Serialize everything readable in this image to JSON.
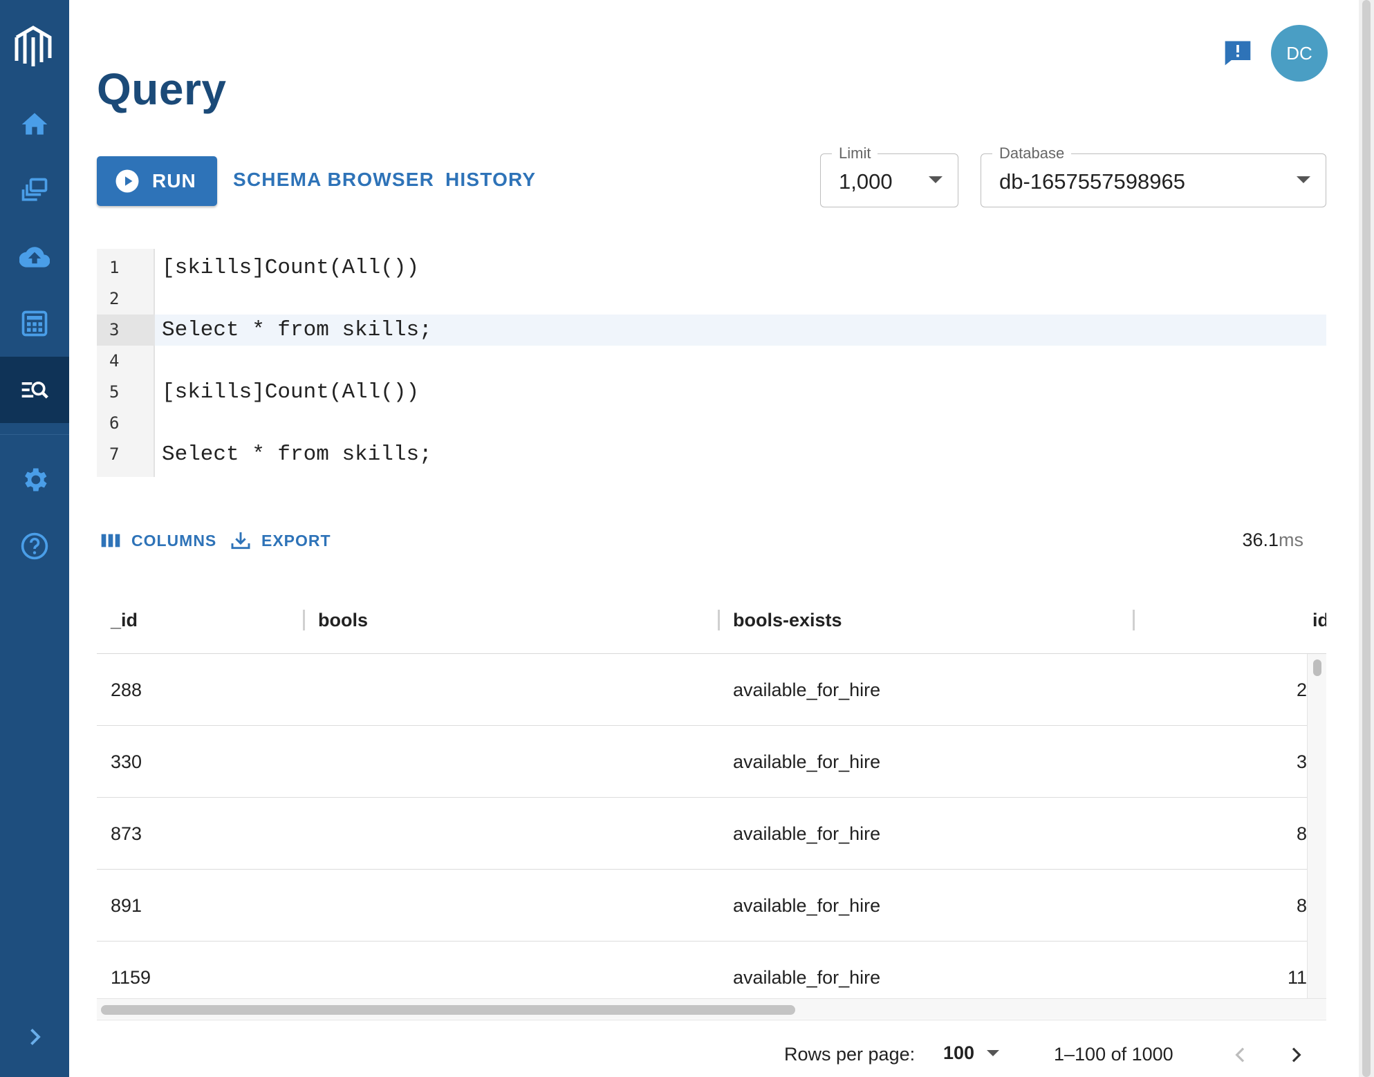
{
  "header": {
    "title": "Query",
    "avatar_initials": "DC"
  },
  "sidebar": {
    "items": [
      {
        "name": "home",
        "icon": "home-icon",
        "active": false
      },
      {
        "name": "collections",
        "icon": "stacked-layers-icon",
        "active": false
      },
      {
        "name": "upload",
        "icon": "cloud-upload-icon",
        "active": false
      },
      {
        "name": "calculator",
        "icon": "calculator-icon",
        "active": false
      },
      {
        "name": "query",
        "icon": "query-search-icon",
        "active": true
      },
      {
        "name": "settings",
        "icon": "gear-icon",
        "active": false
      },
      {
        "name": "help",
        "icon": "help-icon",
        "active": false
      }
    ]
  },
  "toolbar": {
    "run_label": "RUN",
    "schema_label": "SCHEMA BROWSER",
    "history_label": "HISTORY",
    "limit": {
      "label": "Limit",
      "value": "1,000"
    },
    "database": {
      "label": "Database",
      "value": "db-1657557598965"
    }
  },
  "editor": {
    "lines": [
      {
        "num": "1",
        "text": "[skills]Count(All())"
      },
      {
        "num": "2",
        "text": ""
      },
      {
        "num": "3",
        "text": "Select * from skills;"
      },
      {
        "num": "4",
        "text": ""
      },
      {
        "num": "5",
        "text": "[skills]Count(All())"
      },
      {
        "num": "6",
        "text": ""
      },
      {
        "num": "7",
        "text": "Select * from skills;"
      }
    ],
    "highlighted_line": 3
  },
  "results": {
    "columns_label": "COLUMNS",
    "export_label": "EXPORT",
    "timing_value": "36.1",
    "timing_unit": "ms",
    "headers": [
      "_id",
      "bools",
      "bools-exists",
      "id"
    ],
    "rows": [
      {
        "_id": "288",
        "bools": "",
        "bools_exists": "available_for_hire",
        "id": "2"
      },
      {
        "_id": "330",
        "bools": "",
        "bools_exists": "available_for_hire",
        "id": "3"
      },
      {
        "_id": "873",
        "bools": "",
        "bools_exists": "available_for_hire",
        "id": "8"
      },
      {
        "_id": "891",
        "bools": "",
        "bools_exists": "available_for_hire",
        "id": "8"
      },
      {
        "_id": "1159",
        "bools": "",
        "bools_exists": "available_for_hire",
        "id": "11"
      }
    ]
  },
  "pagination": {
    "rows_per_page_label": "Rows per page:",
    "rows_per_page": "100",
    "range": "1–100 of 1000"
  },
  "colors": {
    "sidebar": "#1e4e7e",
    "sidebar_active": "#0f3357",
    "accent": "#2e73b8",
    "title": "#1b4a78",
    "avatar": "#4a9ec4"
  }
}
